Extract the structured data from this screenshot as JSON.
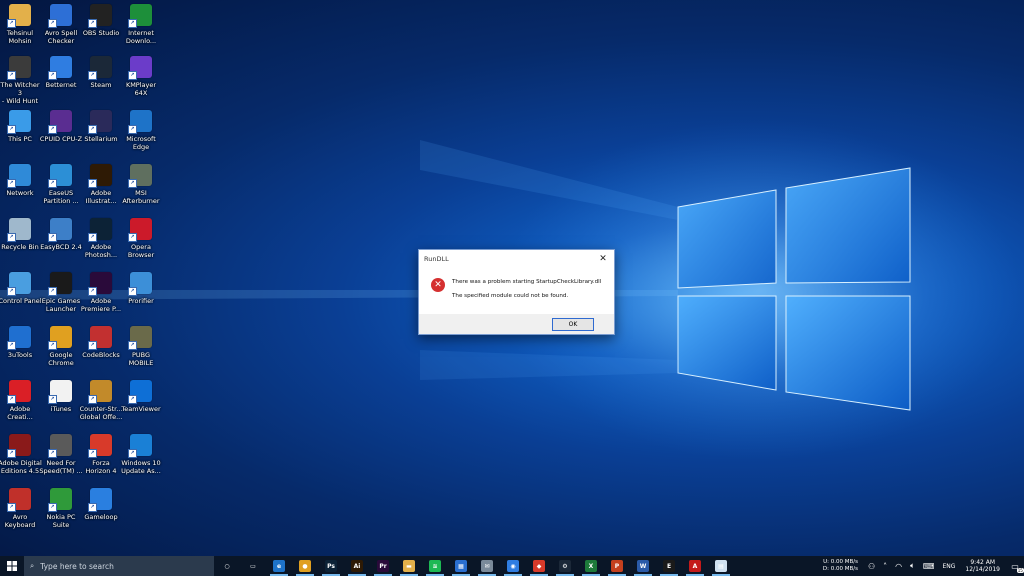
{
  "desktop": {
    "icons": [
      {
        "label": "Tehsinul\nMohsin",
        "icon": "folder-user-icon",
        "color": "#e3b04a"
      },
      {
        "label": "Avro Spell\nChecker",
        "icon": "avro-spell-icon",
        "color": "#2d6fd6"
      },
      {
        "label": "OBS Studio",
        "icon": "obs-icon",
        "color": "#222222"
      },
      {
        "label": "Internet\nDownlo...",
        "icon": "idm-icon",
        "color": "#1d8f3a"
      },
      {
        "label": "The Witcher 3\n- Wild Hunt",
        "icon": "witcher-icon",
        "color": "#3b3b3b"
      },
      {
        "label": "Betternet",
        "icon": "betternet-icon",
        "color": "#2f7de1"
      },
      {
        "label": "Steam",
        "icon": "steam-icon",
        "color": "#1b2838"
      },
      {
        "label": "KMPlayer 64X",
        "icon": "kmplayer-icon",
        "color": "#6b3cc9"
      },
      {
        "label": "This PC",
        "icon": "this-pc-icon",
        "color": "#3a9be8"
      },
      {
        "label": "CPUID CPU-Z",
        "icon": "cpuz-icon",
        "color": "#5a2d91"
      },
      {
        "label": "Stellarium",
        "icon": "stellarium-icon",
        "color": "#2a2a5a"
      },
      {
        "label": "Microsoft\nEdge",
        "icon": "edge-icon",
        "color": "#1e73c8"
      },
      {
        "label": "Network",
        "icon": "network-icon",
        "color": "#2f8ad8"
      },
      {
        "label": "EaseUS\nPartition ...",
        "icon": "easeus-icon",
        "color": "#2c8fd6"
      },
      {
        "label": "Adobe\nIllustrat...",
        "icon": "illustrator-icon",
        "color": "#2e1a05"
      },
      {
        "label": "MSI\nAfterburner",
        "icon": "afterburner-icon",
        "color": "#5f6f5f"
      },
      {
        "label": "Recycle Bin",
        "icon": "recycle-bin-icon",
        "color": "#9fb8cc"
      },
      {
        "label": "EasyBCD 2.4",
        "icon": "easybcd-icon",
        "color": "#3d7fc8"
      },
      {
        "label": "Adobe\nPhotosh...",
        "icon": "photoshop-icon",
        "color": "#0c2236"
      },
      {
        "label": "Opera\nBrowser",
        "icon": "opera-icon",
        "color": "#cc1a2a"
      },
      {
        "label": "Control Panel",
        "icon": "control-panel-icon",
        "color": "#4a9ee0"
      },
      {
        "label": "Epic Games\nLauncher",
        "icon": "epic-games-icon",
        "color": "#1a1a1a"
      },
      {
        "label": "Adobe\nPremiere P...",
        "icon": "premiere-icon",
        "color": "#2a0a3a"
      },
      {
        "label": "Prorifier",
        "icon": "prorifier-icon",
        "color": "#3c8fd8"
      },
      {
        "label": "3uTools",
        "icon": "3utools-icon",
        "color": "#1f6fd0"
      },
      {
        "label": "Google\nChrome",
        "icon": "chrome-icon",
        "color": "#e0a020"
      },
      {
        "label": "CodeBlocks",
        "icon": "codeblocks-icon",
        "color": "#c23030"
      },
      {
        "label": "PUBG\nMOBILE",
        "icon": "pubg-icon",
        "color": "#6a6a4a"
      },
      {
        "label": "Adobe\nCreati...",
        "icon": "creative-cloud-icon",
        "color": "#da1f26"
      },
      {
        "label": "iTunes",
        "icon": "itunes-icon",
        "color": "#f2f2f2"
      },
      {
        "label": "Counter-Str...\nGlobal Offe...",
        "icon": "csgo-icon",
        "color": "#c28a2a"
      },
      {
        "label": "TeamViewer",
        "icon": "teamviewer-icon",
        "color": "#0e6fd6"
      },
      {
        "label": "Adobe Digital\nEditions 4.5",
        "icon": "digital-editions-icon",
        "color": "#8a1a1a"
      },
      {
        "label": "Need For\nSpeed(TM) ...",
        "icon": "nfs-icon",
        "color": "#5a5a5a"
      },
      {
        "label": "Forza\nHorizon 4",
        "icon": "forza-icon",
        "color": "#d83a2a"
      },
      {
        "label": "Windows 10\nUpdate As...",
        "icon": "windows-update-icon",
        "color": "#1a80d6"
      },
      {
        "label": "Avro\nKeyboard",
        "icon": "avro-keyboard-icon",
        "color": "#c0302a"
      },
      {
        "label": "Nokia PC\nSuite",
        "icon": "nokia-suite-icon",
        "color": "#2f9a3a"
      },
      {
        "label": "Gameloop",
        "icon": "gameloop-icon",
        "color": "#2a7fe0"
      }
    ]
  },
  "dialog": {
    "title": "RunDLL",
    "close": "✕",
    "message": "There was a problem starting StartupCheckLibrary.dll",
    "detail": "The specified module could not be found.",
    "ok_label": "OK",
    "error_symbol": "✕"
  },
  "taskbar": {
    "search_placeholder": "Type here to search",
    "pinned": [
      {
        "icon": "cortana-icon",
        "color": "#0a1627",
        "glyph": "○"
      },
      {
        "icon": "task-view-icon",
        "color": "#0a1627",
        "glyph": "▭"
      },
      {
        "icon": "edge-icon",
        "color": "#1e73c8",
        "glyph": "e"
      },
      {
        "icon": "chrome-icon",
        "color": "#e0a020",
        "glyph": "●"
      },
      {
        "icon": "photoshop-icon",
        "color": "#0c2236",
        "glyph": "Ps"
      },
      {
        "icon": "illustrator-icon",
        "color": "#2e1a05",
        "glyph": "Ai"
      },
      {
        "icon": "premiere-icon",
        "color": "#2a0a3a",
        "glyph": "Pr"
      },
      {
        "icon": "file-explorer-icon",
        "color": "#e3b04a",
        "glyph": "▬"
      },
      {
        "icon": "spotify-icon",
        "color": "#1db954",
        "glyph": "≋"
      },
      {
        "icon": "store-icon",
        "color": "#2a6fd0",
        "glyph": "▦"
      },
      {
        "icon": "mail-icon",
        "color": "#7a8a9a",
        "glyph": "✉"
      },
      {
        "icon": "network-globe-icon",
        "color": "#2f7de1",
        "glyph": "◉"
      },
      {
        "icon": "anydesk-icon",
        "color": "#d83a2a",
        "glyph": "◆"
      },
      {
        "icon": "steam-icon",
        "color": "#1b2838",
        "glyph": "⚙"
      },
      {
        "icon": "excel-icon",
        "color": "#1d7a3a",
        "glyph": "X"
      },
      {
        "icon": "powerpoint-icon",
        "color": "#c4401e",
        "glyph": "P"
      },
      {
        "icon": "word-icon",
        "color": "#2a5aa8",
        "glyph": "W"
      },
      {
        "icon": "epic-games-icon",
        "color": "#1a1a1a",
        "glyph": "E"
      },
      {
        "icon": "acrobat-icon",
        "color": "#c41a1a",
        "glyph": "A"
      },
      {
        "icon": "notepad-icon",
        "color": "#cfe0f0",
        "glyph": "▤"
      }
    ],
    "net_up": "0.00 MB/s",
    "net_down": "0.00 MB/s",
    "net_up_label": "U:",
    "net_down_label": "D:",
    "language": "ENG",
    "time": "9:42 AM",
    "date": "12/14/2019",
    "notification_count": "15"
  }
}
